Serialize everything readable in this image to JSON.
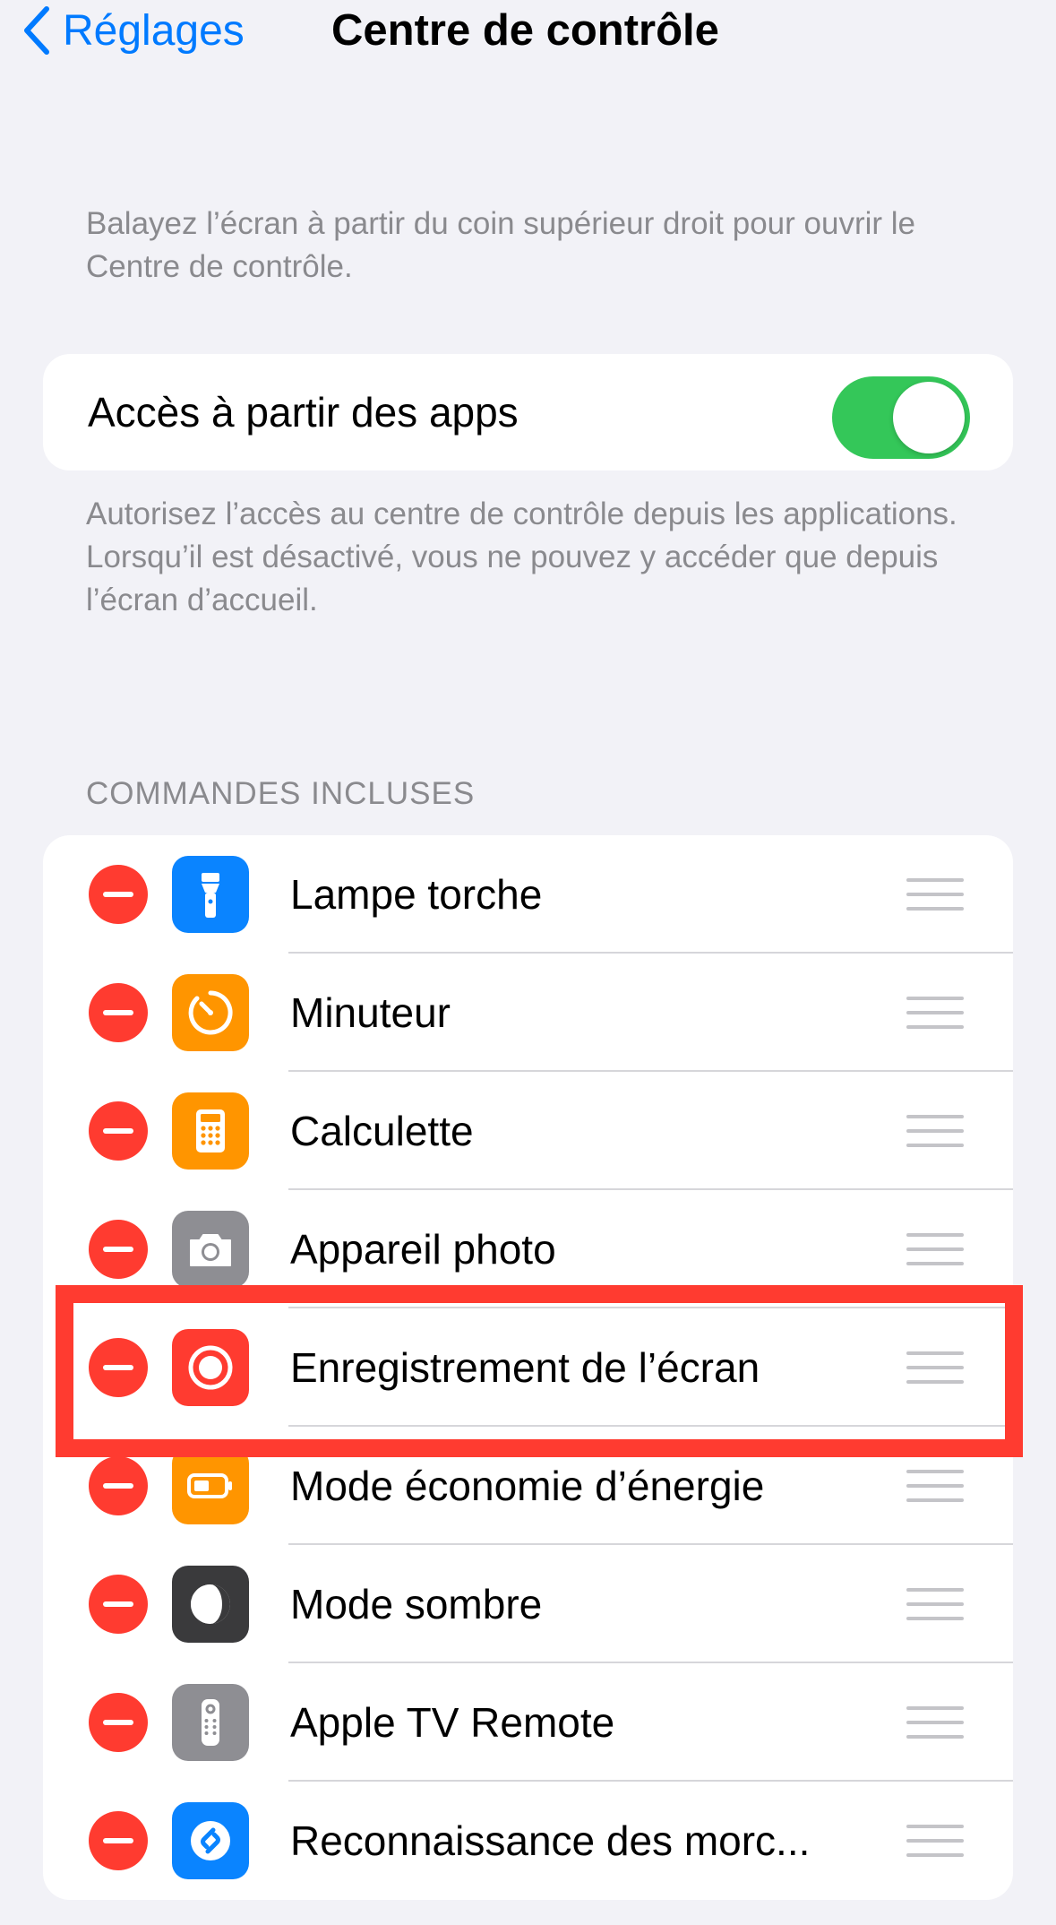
{
  "nav": {
    "back_label": "Réglages",
    "title": "Centre de contrôle"
  },
  "intro_text": "Balayez l’écran à partir du coin supérieur droit pour ouvrir le Centre de contrôle.",
  "access": {
    "label": "Accès à partir des apps",
    "toggle_on": true,
    "footer": "Autorisez l’accès au centre de contrôle depuis les applications. Lorsqu’il est désactivé, vous ne pouvez y accéder que depuis l’écran d’accueil."
  },
  "included": {
    "header": "COMMANDES INCLUSES",
    "items": [
      {
        "label": "Lampe torche",
        "icon": "flashlight-icon",
        "color": "#0A84FF"
      },
      {
        "label": "Minuteur",
        "icon": "timer-icon",
        "color": "#FF9500"
      },
      {
        "label": "Calculette",
        "icon": "calculator-icon",
        "color": "#FF9500"
      },
      {
        "label": "Appareil photo",
        "icon": "camera-icon",
        "color": "#8E8E93"
      },
      {
        "label": "Enregistrement de l’écran",
        "icon": "screen-recording-icon",
        "color": "#FF3B30"
      },
      {
        "label": "Mode économie d’énergie",
        "icon": "battery-icon",
        "color": "#FF9500"
      },
      {
        "label": "Mode sombre",
        "icon": "dark-mode-icon",
        "color": "#3A3A3C"
      },
      {
        "label": "Apple TV Remote",
        "icon": "remote-icon",
        "color": "#8E8E93"
      },
      {
        "label": "Reconnaissance des morc...",
        "icon": "shazam-icon",
        "color": "#0A84FF"
      }
    ]
  },
  "colors": {
    "accent": "#007AFF",
    "toggle_on": "#34C759",
    "remove": "#FF3B30",
    "highlight": "#FF3B30"
  }
}
